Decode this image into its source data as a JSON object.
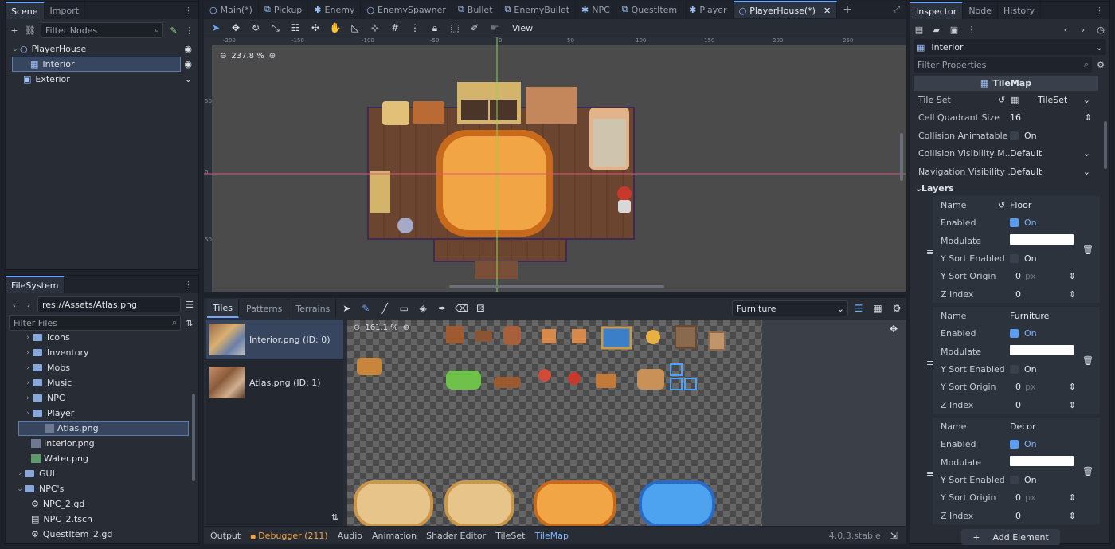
{
  "scene_dock": {
    "tabs": [
      "Scene",
      "Import"
    ],
    "filter_placeholder": "Filter Nodes",
    "tree": [
      {
        "label": "PlayerHouse"
      },
      {
        "label": "Interior"
      },
      {
        "label": "Exterior"
      }
    ]
  },
  "filesystem_dock": {
    "tab": "FileSystem",
    "path": "res://Assets/Atlas.png",
    "filter_placeholder": "Filter Files",
    "items": [
      {
        "label": "Icons",
        "type": "folder"
      },
      {
        "label": "Inventory",
        "type": "folder"
      },
      {
        "label": "Mobs",
        "type": "folder"
      },
      {
        "label": "Music",
        "type": "folder"
      },
      {
        "label": "NPC",
        "type": "folder"
      },
      {
        "label": "Player",
        "type": "folder"
      },
      {
        "label": "Atlas.png",
        "type": "image"
      },
      {
        "label": "Interior.png",
        "type": "image"
      },
      {
        "label": "Water.png",
        "type": "image"
      },
      {
        "label": "GUI",
        "type": "folder"
      },
      {
        "label": "NPC's",
        "type": "folder"
      },
      {
        "label": "NPC_2.gd",
        "type": "script"
      },
      {
        "label": "NPC_2.tscn",
        "type": "scene"
      },
      {
        "label": "QuestItem_2.gd",
        "type": "script"
      }
    ]
  },
  "editor_tabs": [
    "Main(*)",
    "Pickup",
    "Enemy",
    "EnemySpawner",
    "Bullet",
    "EnemyBullet",
    "NPC",
    "QuestItem",
    "Player",
    "PlayerHouse(*)"
  ],
  "viewport": {
    "zoom": "237.8 %",
    "view_menu": "View",
    "ruler_labels": [
      "-200",
      "-150",
      "-100",
      "-50",
      "0",
      "50",
      "100",
      "150",
      "200",
      "250"
    ],
    "vruler_labels": [
      "50",
      "0",
      "50"
    ]
  },
  "tilemap_panel": {
    "tabs": [
      "Tiles",
      "Patterns",
      "Terrains"
    ],
    "layer_select": "Furniture",
    "zoom": "161.1 %",
    "sources": [
      {
        "label": "Interior.png (ID: 0)"
      },
      {
        "label": "Atlas.png (ID: 1)"
      }
    ]
  },
  "bottom_bar": {
    "tabs": [
      "Output",
      "Debugger (211)",
      "Audio",
      "Animation",
      "Shader Editor",
      "TileSet",
      "TileMap"
    ],
    "version": "4.0.3.stable"
  },
  "inspector": {
    "tabs": [
      "Inspector",
      "Node",
      "History"
    ],
    "object": "Interior",
    "filter_placeholder": "Filter Properties",
    "class_header": "TileMap",
    "tile_set_label": "Tile Set",
    "tile_set_value": "TileSet",
    "props": [
      {
        "k": "Cell Quadrant Size",
        "v": "16"
      },
      {
        "k": "Collision Animatable",
        "v": "On"
      },
      {
        "k": "Collision Visibility M...",
        "v": "Default"
      },
      {
        "k": "Navigation Visibility ...",
        "v": "Default"
      }
    ],
    "layers_header": "Layers",
    "layers": [
      {
        "name": "Floor",
        "enabled": "On",
        "ysort": "On",
        "yorigin": "0",
        "zindex": "0"
      },
      {
        "name": "Furniture",
        "enabled": "On",
        "ysort": "On",
        "yorigin": "0",
        "zindex": "0"
      },
      {
        "name": "Decor",
        "enabled": "On",
        "ysort": "On",
        "yorigin": "0",
        "zindex": "0"
      }
    ],
    "layer_keys": {
      "name": "Name",
      "enabled": "Enabled",
      "modulate": "Modulate",
      "ysort": "Y Sort Enabled",
      "yorigin": "Y Sort Origin",
      "zindex": "Z Index",
      "px": "px"
    },
    "add_element": "Add Element"
  }
}
